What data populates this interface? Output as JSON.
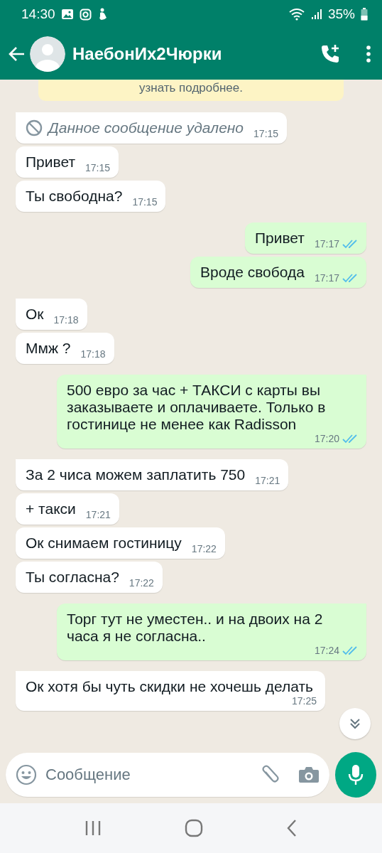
{
  "status_bar": {
    "time": "14:30",
    "battery": "35%"
  },
  "header": {
    "contact_name": "НаебонИх2Чюрки"
  },
  "chat": {
    "notice": "узнать подробнее.",
    "groups": [
      {
        "kind": "incoming",
        "messages": [
          {
            "kind": "deleted",
            "text": "Данное сообщение удалено",
            "time": "17:15"
          },
          {
            "kind": "text",
            "text": "Привет",
            "time": "17:15"
          },
          {
            "kind": "text",
            "text": "Ты свободна?",
            "time": "17:15"
          }
        ]
      },
      {
        "kind": "outgoing",
        "messages": [
          {
            "kind": "text",
            "text": "Привет",
            "time": "17:17",
            "read": true
          },
          {
            "kind": "text",
            "text": "Вроде свобода",
            "time": "17:17",
            "read": true
          }
        ]
      },
      {
        "kind": "incoming",
        "messages": [
          {
            "kind": "text",
            "text": "Ок",
            "time": "17:18"
          },
          {
            "kind": "text",
            "text": "Ммж ?",
            "time": "17:18"
          }
        ]
      },
      {
        "kind": "outgoing",
        "messages": [
          {
            "kind": "text",
            "text": "500 евро за час + ТАКСИ с карты вы заказываете и оплачиваете.  Только в гостинице не менее как Radisson",
            "time": "17:20",
            "read": true
          }
        ]
      },
      {
        "kind": "incoming",
        "messages": [
          {
            "kind": "text",
            "text": "За 2 чиса можем заплатить 750",
            "time": "17:21"
          },
          {
            "kind": "text",
            "text": "+ такси",
            "time": "17:21"
          },
          {
            "kind": "text",
            "text": "Ок снимаем гостиницу",
            "time": "17:22"
          },
          {
            "kind": "text",
            "text": "Ты согласна?",
            "time": "17:22"
          }
        ]
      },
      {
        "kind": "outgoing",
        "messages": [
          {
            "kind": "text",
            "text": "Торг тут не уместен.. и на двоих на 2 часа я не согласна..",
            "time": "17:24",
            "read": true
          }
        ]
      },
      {
        "kind": "incoming",
        "messages": [
          {
            "kind": "text",
            "text": "Ок хотя бы чуть скидки не хочешь делать",
            "time": "17:25"
          }
        ]
      }
    ]
  },
  "composer": {
    "placeholder": "Сообщение"
  }
}
